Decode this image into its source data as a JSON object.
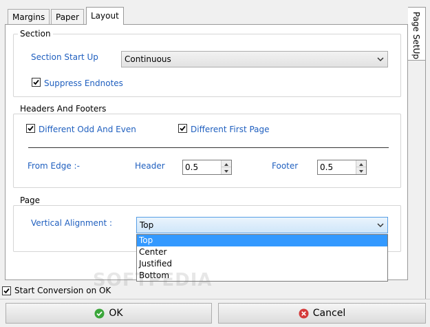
{
  "tabs": {
    "margins": "Margins",
    "paper": "Paper",
    "layout": "Layout",
    "page_setup": "Page SetUp"
  },
  "section": {
    "title": "Section",
    "start_label": "Section Start Up",
    "start_value": "Continuous",
    "suppress_endnotes_label": "Suppress Endnotes",
    "suppress_endnotes_checked": true
  },
  "headers_footers": {
    "title": "Headers And Footers",
    "odd_even_label": "Different Odd And Even",
    "odd_even_checked": true,
    "first_page_label": "Different First Page",
    "first_page_checked": true,
    "from_edge_label": "From Edge :-",
    "header_label": "Header",
    "header_value": "0.5",
    "footer_label": "Footer",
    "footer_value": "0.5"
  },
  "page": {
    "title": "Page",
    "vertical_alignment_label": "Vertical Alignment :",
    "vertical_alignment_value": "Top",
    "options": [
      "Top",
      "Center",
      "Justified",
      "Bottom"
    ]
  },
  "start_conversion": {
    "label": "Start Conversion on OK",
    "checked": true
  },
  "buttons": {
    "ok": "OK",
    "cancel": "Cancel"
  },
  "watermark": "SOFTPEDIA",
  "colors": {
    "label_blue": "#1f5fbf",
    "selection": "#3399ff",
    "ok_icon": "#3aa63a",
    "cancel_icon": "#d43a3a"
  }
}
